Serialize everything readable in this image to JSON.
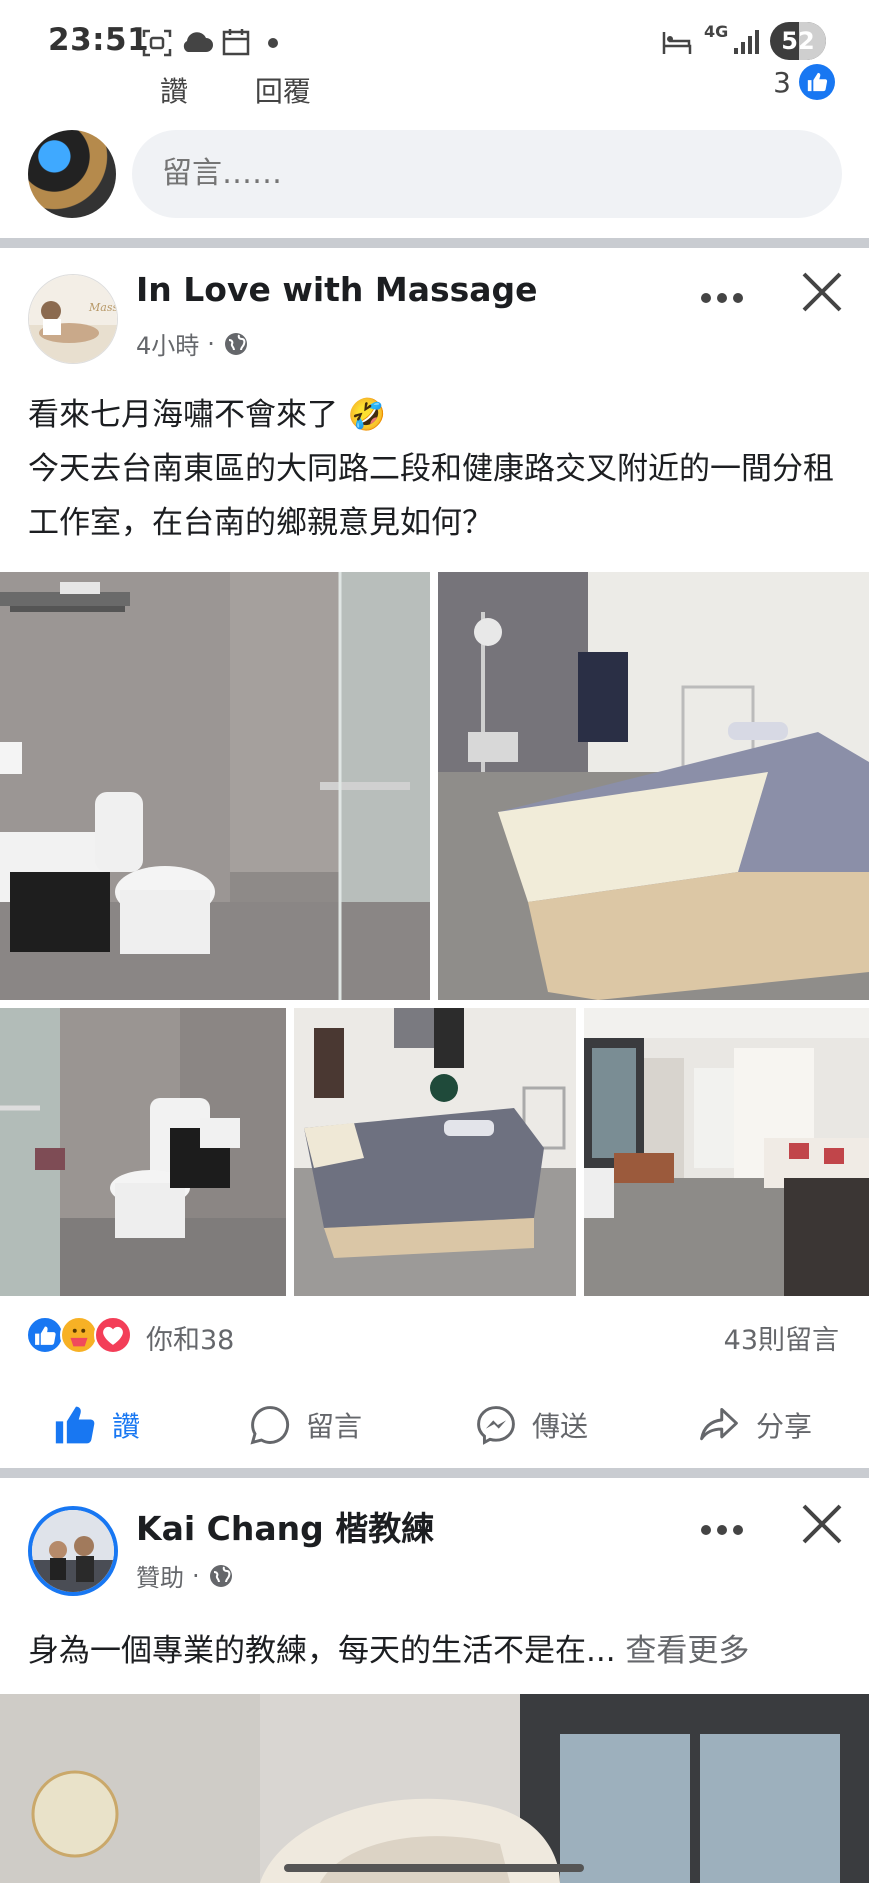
{
  "status_bar": {
    "time": "23:51",
    "network": "4G",
    "battery": "52",
    "battery_level": 0.52
  },
  "previous_post": {
    "like_label": "讚",
    "reply_label": "回覆",
    "like_count": "3",
    "comment_placeholder": "留言……"
  },
  "post": {
    "author": "In Love with Massage",
    "time": "4小時",
    "text_line1": "看來七月海嘯不會來了",
    "text_emoji": "🤣",
    "text_rest": "今天去台南東區的大同路二段和健康路交叉附近的一間分租工作室，在台南的鄉親意見如何？",
    "reaction_summary": "你和38",
    "comment_count": "43則留言",
    "actions": {
      "like": "讚",
      "comment": "留言",
      "send": "傳送",
      "share": "分享"
    }
  },
  "sponsored_post": {
    "author": "Kai Chang 楷教練",
    "label": "贊助",
    "text": "身為一個專業的教練，每天的生活不是在...",
    "see_more": "查看更多"
  },
  "colors": {
    "accent": "#1877f2",
    "secondary_text": "#65676b",
    "divider": "#c9ccd1",
    "input_bg": "#f0f2f5"
  },
  "icons": [
    "scan-icon",
    "cloud-icon",
    "calendar-icon",
    "bed-icon",
    "signal-icon",
    "globe-icon",
    "more-icon",
    "close-icon",
    "like-icon",
    "comment-icon",
    "messenger-icon",
    "share-icon"
  ]
}
